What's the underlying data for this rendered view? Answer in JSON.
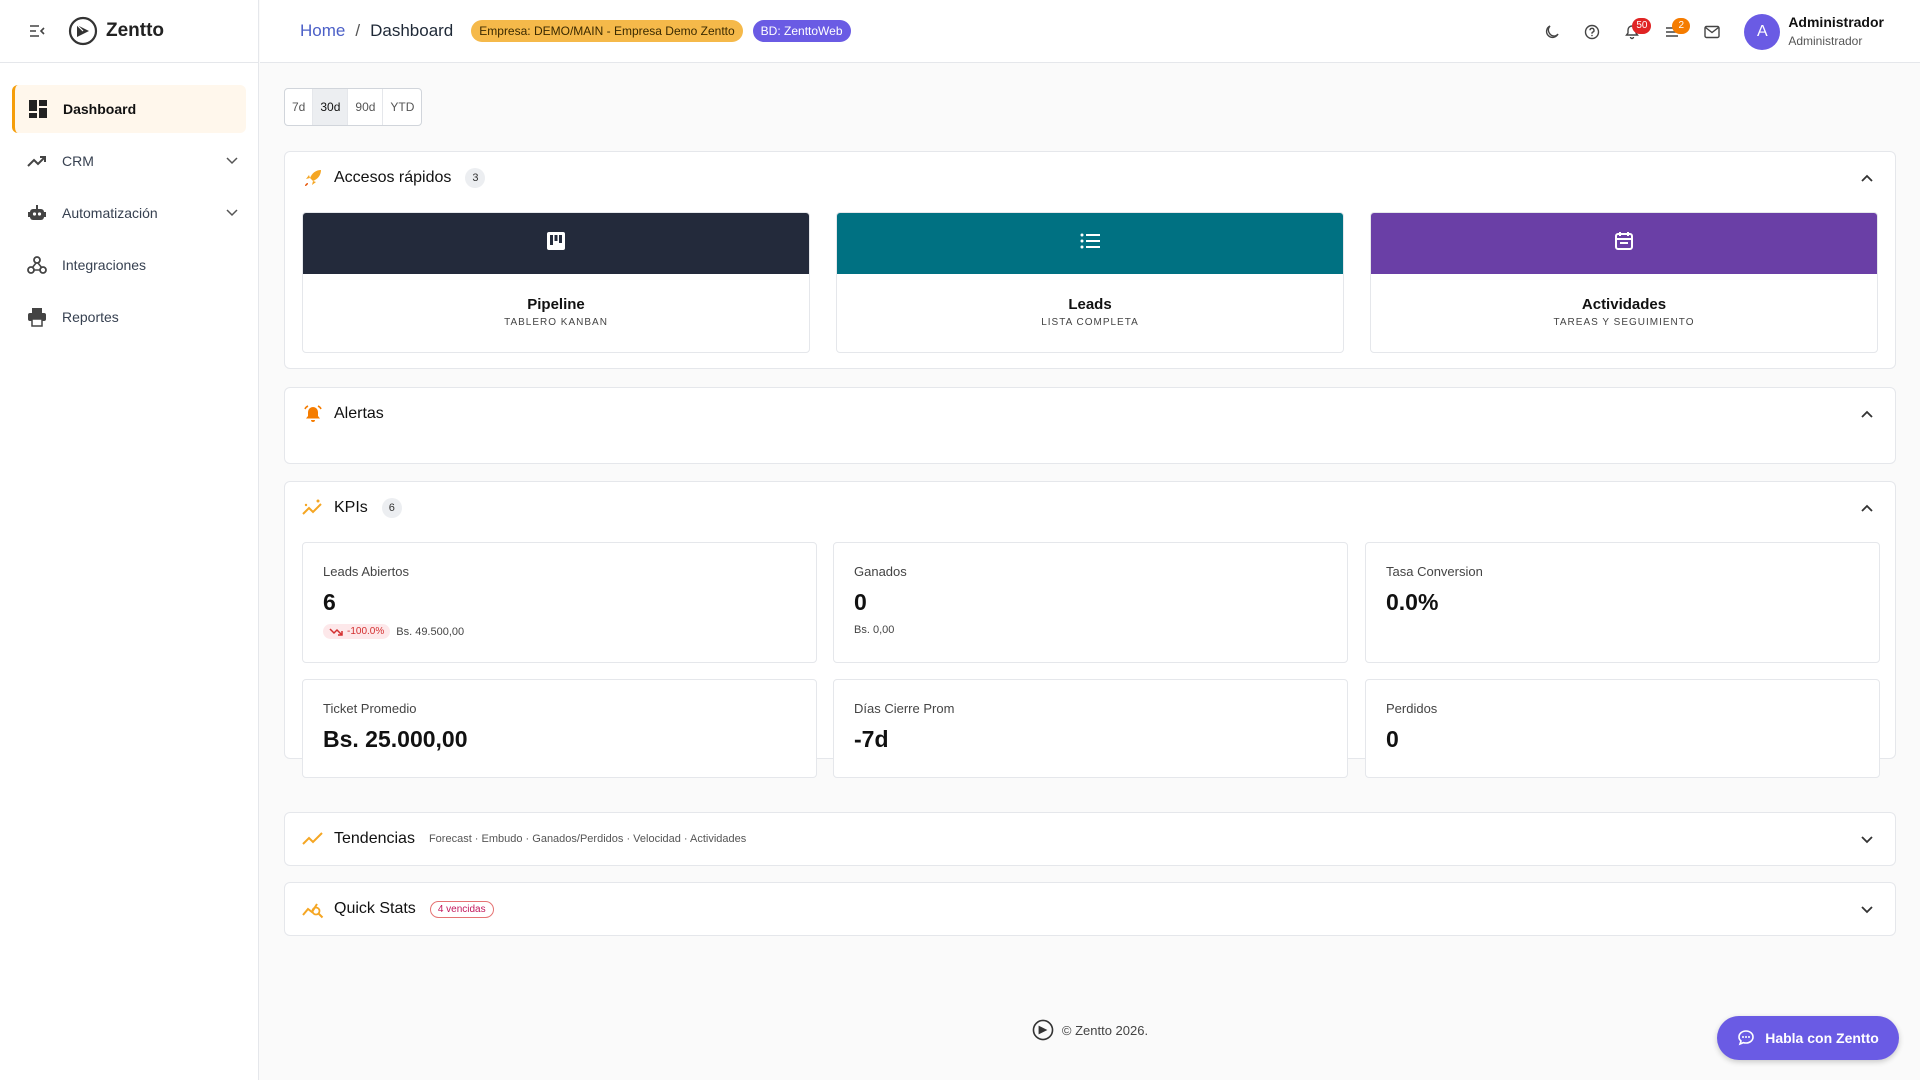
{
  "brand": {
    "name": "Zentto"
  },
  "sidebar": {
    "items": [
      {
        "label": "Dashboard",
        "icon": "dashboard-icon",
        "active": true
      },
      {
        "label": "CRM",
        "icon": "trending-up-icon",
        "expandable": true
      },
      {
        "label": "Automatización",
        "icon": "robot-icon",
        "expandable": true
      },
      {
        "label": "Integraciones",
        "icon": "webhook-icon"
      },
      {
        "label": "Reportes",
        "icon": "printer-icon"
      }
    ]
  },
  "header": {
    "breadcrumb": {
      "home": "Home",
      "separator": "/",
      "current": "Dashboard"
    },
    "empresa_chip": "Empresa: DEMO/MAIN - Empresa Demo Zentto",
    "bd_chip": "BD: ZenttoWeb",
    "notifications_count": "50",
    "tasks_count": "2",
    "user": {
      "avatar_letter": "A",
      "name": "Administrador",
      "role": "Administrador"
    }
  },
  "range": {
    "options": [
      "7d",
      "30d",
      "90d",
      "YTD"
    ],
    "selected": "30d"
  },
  "quick_access": {
    "title": "Accesos rápidos",
    "count": "3",
    "cards": [
      {
        "title": "Pipeline",
        "subtitle": "TABLERO KANBAN",
        "color": "#232a3b",
        "icon": "kanban-icon"
      },
      {
        "title": "Leads",
        "subtitle": "LISTA COMPLETA",
        "color": "#007182",
        "icon": "list-icon"
      },
      {
        "title": "Actividades",
        "subtitle": "TAREAS Y SEGUIMIENTO",
        "color": "#6a3fa6",
        "icon": "calendar-icon"
      }
    ]
  },
  "alerts": {
    "title": "Alertas"
  },
  "kpis": {
    "title": "KPIs",
    "count": "6",
    "items": [
      {
        "label": "Leads Abiertos",
        "value": "6",
        "trend": "-100.0%",
        "extra": "Bs. 49.500,00"
      },
      {
        "label": "Ganados",
        "value": "0",
        "extra": "Bs. 0,00"
      },
      {
        "label": "Tasa Conversion",
        "value": "0.0%"
      },
      {
        "label": "Ticket Promedio",
        "value": "Bs. 25.000,00"
      },
      {
        "label": "Días Cierre Prom",
        "value": "-7d"
      },
      {
        "label": "Perdidos",
        "value": "0"
      }
    ]
  },
  "tendencias": {
    "title": "Tendencias",
    "subtitle": "Forecast · Embudo · Ganados/Perdidos · Velocidad · Actividades"
  },
  "quick_stats": {
    "title": "Quick Stats",
    "badge": "4 vencidas"
  },
  "footer": {
    "text": "© Zentto 2026."
  },
  "chat": {
    "label": "Habla con Zentto"
  },
  "colors": {
    "accent": "#f59e0b",
    "primary": "#6a5be4",
    "link": "#4b5fc7",
    "danger": "#e02424"
  }
}
